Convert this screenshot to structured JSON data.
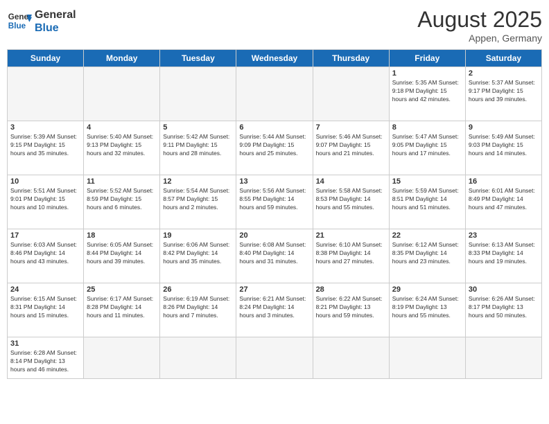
{
  "header": {
    "logo_general": "General",
    "logo_blue": "Blue",
    "month_title": "August 2025",
    "location": "Appen, Germany"
  },
  "weekdays": [
    "Sunday",
    "Monday",
    "Tuesday",
    "Wednesday",
    "Thursday",
    "Friday",
    "Saturday"
  ],
  "weeks": [
    [
      {
        "day": "",
        "info": "",
        "empty": true
      },
      {
        "day": "",
        "info": "",
        "empty": true
      },
      {
        "day": "",
        "info": "",
        "empty": true
      },
      {
        "day": "",
        "info": "",
        "empty": true
      },
      {
        "day": "",
        "info": "",
        "empty": true
      },
      {
        "day": "1",
        "info": "Sunrise: 5:35 AM\nSunset: 9:18 PM\nDaylight: 15 hours\nand 42 minutes."
      },
      {
        "day": "2",
        "info": "Sunrise: 5:37 AM\nSunset: 9:17 PM\nDaylight: 15 hours\nand 39 minutes."
      }
    ],
    [
      {
        "day": "3",
        "info": "Sunrise: 5:39 AM\nSunset: 9:15 PM\nDaylight: 15 hours\nand 35 minutes."
      },
      {
        "day": "4",
        "info": "Sunrise: 5:40 AM\nSunset: 9:13 PM\nDaylight: 15 hours\nand 32 minutes."
      },
      {
        "day": "5",
        "info": "Sunrise: 5:42 AM\nSunset: 9:11 PM\nDaylight: 15 hours\nand 28 minutes."
      },
      {
        "day": "6",
        "info": "Sunrise: 5:44 AM\nSunset: 9:09 PM\nDaylight: 15 hours\nand 25 minutes."
      },
      {
        "day": "7",
        "info": "Sunrise: 5:46 AM\nSunset: 9:07 PM\nDaylight: 15 hours\nand 21 minutes."
      },
      {
        "day": "8",
        "info": "Sunrise: 5:47 AM\nSunset: 9:05 PM\nDaylight: 15 hours\nand 17 minutes."
      },
      {
        "day": "9",
        "info": "Sunrise: 5:49 AM\nSunset: 9:03 PM\nDaylight: 15 hours\nand 14 minutes."
      }
    ],
    [
      {
        "day": "10",
        "info": "Sunrise: 5:51 AM\nSunset: 9:01 PM\nDaylight: 15 hours\nand 10 minutes."
      },
      {
        "day": "11",
        "info": "Sunrise: 5:52 AM\nSunset: 8:59 PM\nDaylight: 15 hours\nand 6 minutes."
      },
      {
        "day": "12",
        "info": "Sunrise: 5:54 AM\nSunset: 8:57 PM\nDaylight: 15 hours\nand 2 minutes."
      },
      {
        "day": "13",
        "info": "Sunrise: 5:56 AM\nSunset: 8:55 PM\nDaylight: 14 hours\nand 59 minutes."
      },
      {
        "day": "14",
        "info": "Sunrise: 5:58 AM\nSunset: 8:53 PM\nDaylight: 14 hours\nand 55 minutes."
      },
      {
        "day": "15",
        "info": "Sunrise: 5:59 AM\nSunset: 8:51 PM\nDaylight: 14 hours\nand 51 minutes."
      },
      {
        "day": "16",
        "info": "Sunrise: 6:01 AM\nSunset: 8:49 PM\nDaylight: 14 hours\nand 47 minutes."
      }
    ],
    [
      {
        "day": "17",
        "info": "Sunrise: 6:03 AM\nSunset: 8:46 PM\nDaylight: 14 hours\nand 43 minutes."
      },
      {
        "day": "18",
        "info": "Sunrise: 6:05 AM\nSunset: 8:44 PM\nDaylight: 14 hours\nand 39 minutes."
      },
      {
        "day": "19",
        "info": "Sunrise: 6:06 AM\nSunset: 8:42 PM\nDaylight: 14 hours\nand 35 minutes."
      },
      {
        "day": "20",
        "info": "Sunrise: 6:08 AM\nSunset: 8:40 PM\nDaylight: 14 hours\nand 31 minutes."
      },
      {
        "day": "21",
        "info": "Sunrise: 6:10 AM\nSunset: 8:38 PM\nDaylight: 14 hours\nand 27 minutes."
      },
      {
        "day": "22",
        "info": "Sunrise: 6:12 AM\nSunset: 8:35 PM\nDaylight: 14 hours\nand 23 minutes."
      },
      {
        "day": "23",
        "info": "Sunrise: 6:13 AM\nSunset: 8:33 PM\nDaylight: 14 hours\nand 19 minutes."
      }
    ],
    [
      {
        "day": "24",
        "info": "Sunrise: 6:15 AM\nSunset: 8:31 PM\nDaylight: 14 hours\nand 15 minutes."
      },
      {
        "day": "25",
        "info": "Sunrise: 6:17 AM\nSunset: 8:28 PM\nDaylight: 14 hours\nand 11 minutes."
      },
      {
        "day": "26",
        "info": "Sunrise: 6:19 AM\nSunset: 8:26 PM\nDaylight: 14 hours\nand 7 minutes."
      },
      {
        "day": "27",
        "info": "Sunrise: 6:21 AM\nSunset: 8:24 PM\nDaylight: 14 hours\nand 3 minutes."
      },
      {
        "day": "28",
        "info": "Sunrise: 6:22 AM\nSunset: 8:21 PM\nDaylight: 13 hours\nand 59 minutes."
      },
      {
        "day": "29",
        "info": "Sunrise: 6:24 AM\nSunset: 8:19 PM\nDaylight: 13 hours\nand 55 minutes."
      },
      {
        "day": "30",
        "info": "Sunrise: 6:26 AM\nSunset: 8:17 PM\nDaylight: 13 hours\nand 50 minutes."
      }
    ],
    [
      {
        "day": "31",
        "info": "Sunrise: 6:28 AM\nSunset: 8:14 PM\nDaylight: 13 hours\nand 46 minutes."
      },
      {
        "day": "",
        "info": "",
        "empty": true
      },
      {
        "day": "",
        "info": "",
        "empty": true
      },
      {
        "day": "",
        "info": "",
        "empty": true
      },
      {
        "day": "",
        "info": "",
        "empty": true
      },
      {
        "day": "",
        "info": "",
        "empty": true
      },
      {
        "day": "",
        "info": "",
        "empty": true
      }
    ]
  ]
}
